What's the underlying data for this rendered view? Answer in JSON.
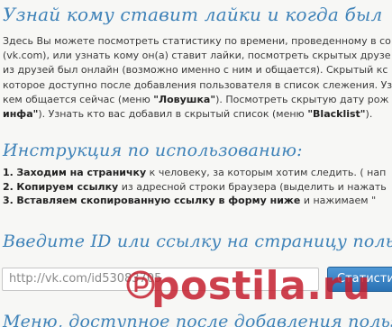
{
  "headings": {
    "main": "Узнай кому ставит лайки и когда был",
    "instruction": "Инструкция по использованию:",
    "input": "Введите ID или ссылку на страницу польз",
    "menu": "Меню, доступное после добавления пользо"
  },
  "intro": {
    "line1": "Здесь Вы можете посмотреть статистику по времени, проведенному в со",
    "line2": "(vk.com), или узнать кому он(а) ставит лайки, посмотреть скрытых друзе",
    "line3": "из друзей был онлайн (возможно именно с ним и общается). Скрытый кс",
    "line4": "которое доступно после добавления пользователя в список слежения. Уз",
    "line5_pre": "кем общается сейчас (меню ",
    "line5_bold": "\"Ловушка\"",
    "line5_post": "). Посмотреть скрытую дату рож",
    "line6_bold1": "инфа\"",
    "line6_mid": "). Узнать кто вас добавил в скрытый список (меню ",
    "line6_bold2": "\"Blacklist\"",
    "line6_post": ")."
  },
  "steps": [
    {
      "num": "1.",
      "bold": "Заходим на страничку",
      "rest": " к человеку, за которым хотим следить. ( нап"
    },
    {
      "num": "2.",
      "bold": "Копируем ссылку",
      "rest": " из адресной строки браузера (выделить и нажать"
    },
    {
      "num": "3.",
      "bold": "Вставляем скопированную ссылку в форму ниже",
      "rest": " и нажимаем \""
    }
  ],
  "search": {
    "input_value": "http://vk.com/id53083705",
    "button_label": "Статисти"
  },
  "watermark": {
    "text": "postila.ru"
  },
  "colors": {
    "heading": "#3e82b8",
    "button": "#2a72b4",
    "watermark": "#c41e2e"
  }
}
